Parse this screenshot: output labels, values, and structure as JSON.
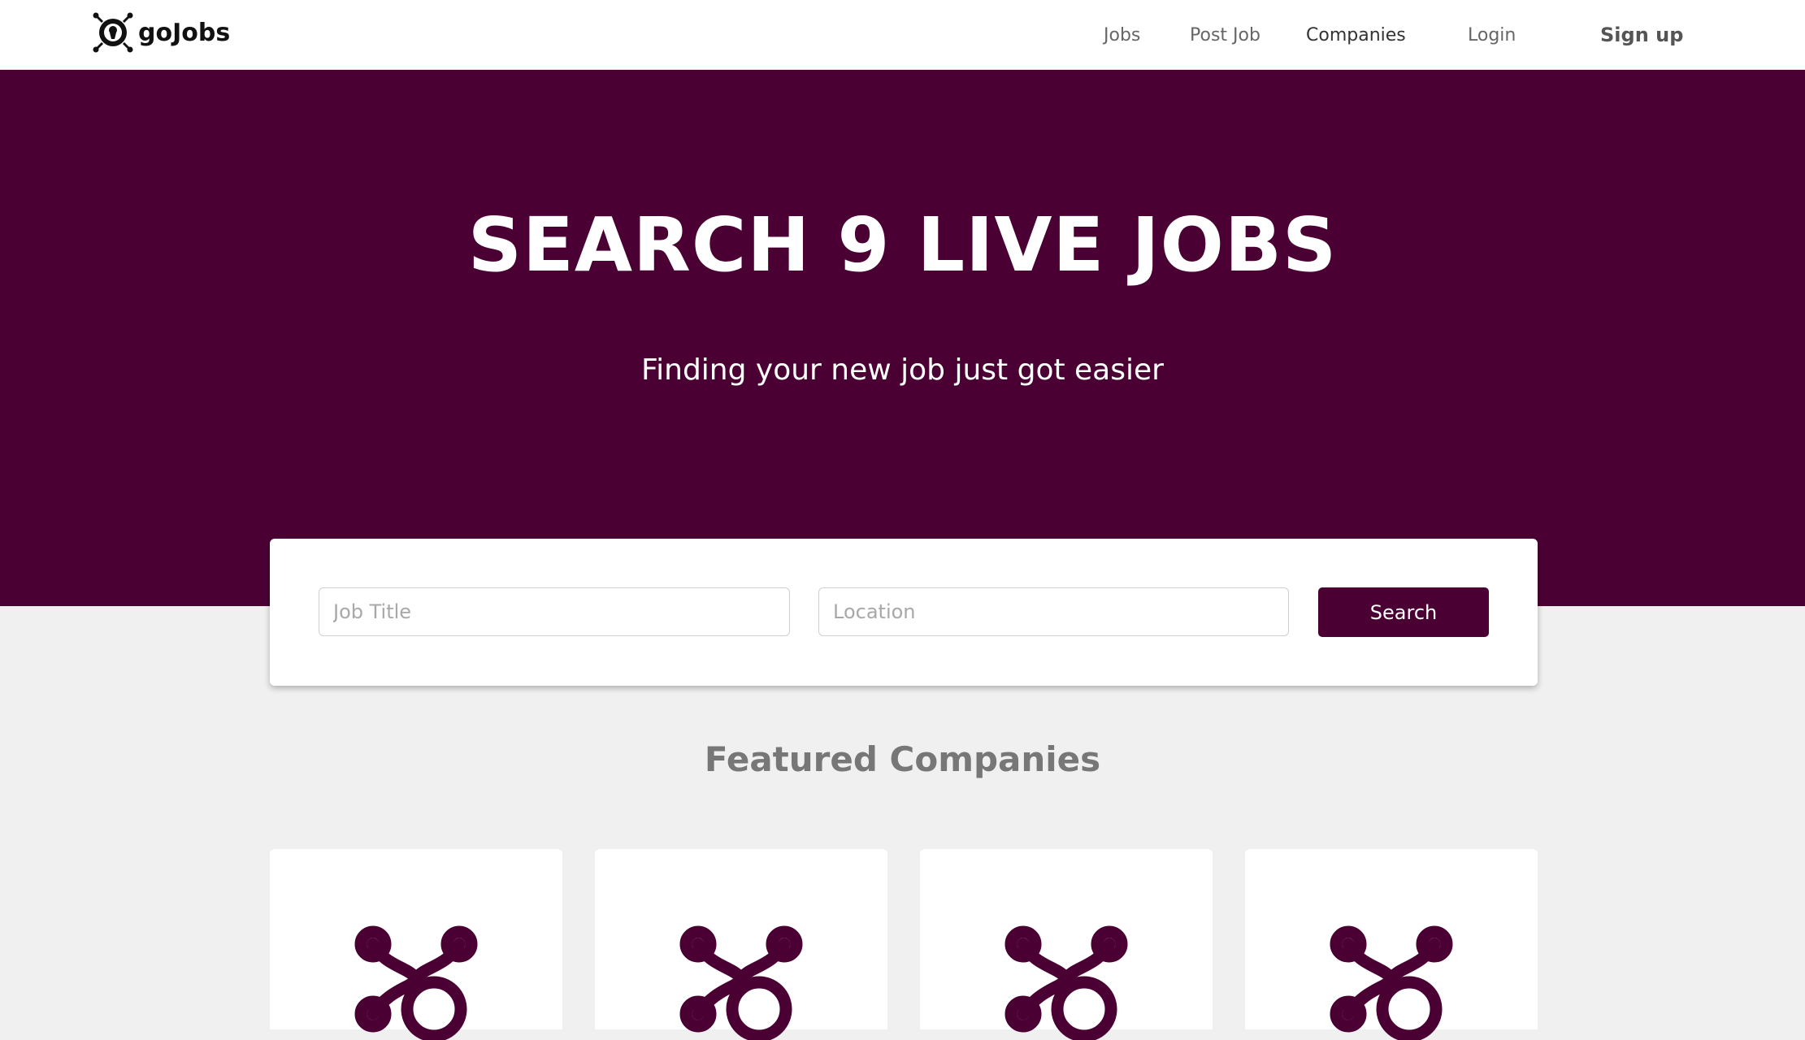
{
  "brand": {
    "name": "goJobs",
    "icon": "gojobs-logo-icon"
  },
  "nav": {
    "jobs": "Jobs",
    "post_job": "Post Job",
    "companies": "Companies",
    "login": "Login",
    "signup": "Sign up"
  },
  "hero": {
    "title": "SEARCH 9 LIVE JOBS",
    "subtitle": "Finding your new job just got easier"
  },
  "search": {
    "job_title_placeholder": "Job Title",
    "job_title_value": "",
    "location_placeholder": "Location",
    "location_value": "",
    "button_label": "Search"
  },
  "featured": {
    "title": "Featured Companies",
    "companies": [
      {
        "logo_icon": "company-logo-icon"
      },
      {
        "logo_icon": "company-logo-icon"
      },
      {
        "logo_icon": "company-logo-icon"
      },
      {
        "logo_icon": "company-logo-icon"
      }
    ]
  },
  "colors": {
    "primary": "#4a0033",
    "background": "#f0f0f0",
    "header_bg": "#ffffff",
    "muted_heading": "#777777"
  }
}
